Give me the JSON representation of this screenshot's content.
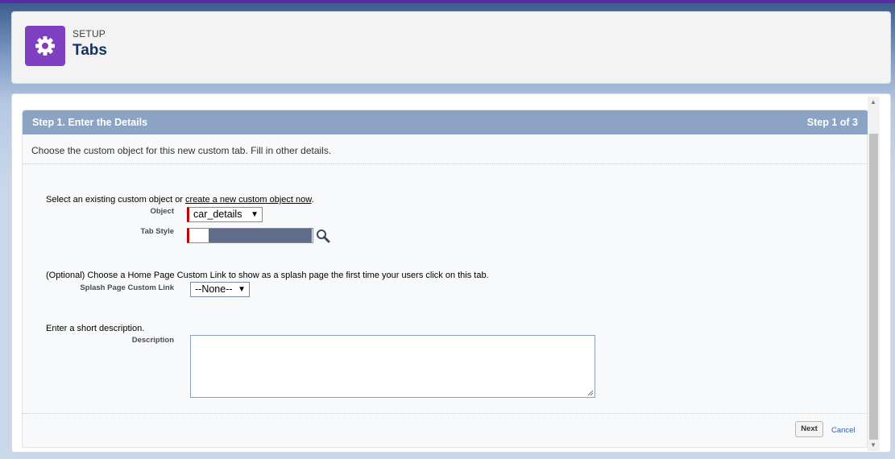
{
  "header": {
    "eyebrow": "SETUP",
    "title": "Tabs",
    "icon": "gear-icon",
    "icon_bg": "#7e3fc0"
  },
  "wizard": {
    "step_title": "Step 1. Enter the Details",
    "step_count": "Step 1 of 3",
    "intro": "Choose the custom object for this new custom tab. Fill in other details.",
    "object_prompt_prefix": "Select an existing custom object or ",
    "object_prompt_link": "create a new custom object now",
    "object_prompt_suffix": ".",
    "object_label": "Object",
    "object_value": "car_details",
    "tab_style_label": "Tab Style",
    "splash_prompt": "(Optional) Choose a Home Page Custom Link to show as a splash page the first time your users click on this tab.",
    "splash_label": "Splash Page Custom Link",
    "splash_value": "--None--",
    "description_prompt": "Enter a short description.",
    "description_label": "Description",
    "description_value": "",
    "next_label": "Next",
    "cancel_label": "Cancel"
  },
  "colors": {
    "header_band": "#8da3c4",
    "required_marker": "#c00000",
    "link": "#3060a0"
  }
}
